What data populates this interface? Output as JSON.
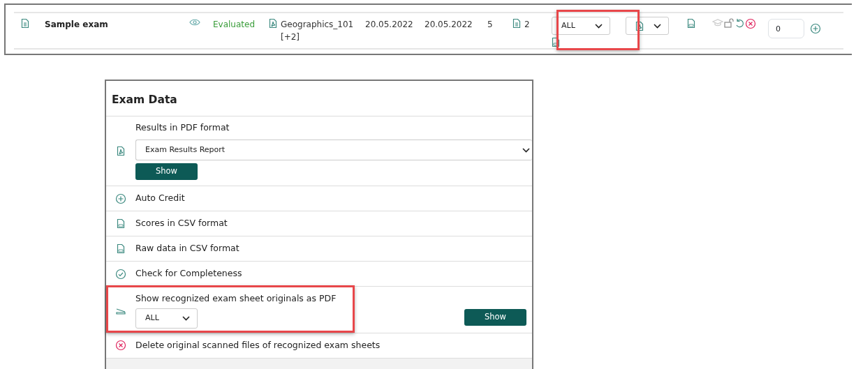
{
  "exam_row": {
    "name": "Sample exam",
    "status": "Evaluated",
    "file": "Geographics_101",
    "file_extra": "[+2]",
    "date_1": "20.05.2022",
    "date_2": "20.05.2022",
    "count": "5",
    "sheets": "2",
    "scope_select": {
      "value": "ALL",
      "highlighted": true
    },
    "points": "0"
  },
  "panel": {
    "title": "Exam Data",
    "items": [
      {
        "kind": "select_action",
        "label": "Results in PDF format",
        "select_value": "Exam Results Report",
        "button": "Show",
        "highlighted": false
      },
      {
        "kind": "plain",
        "label": "Auto Credit",
        "highlighted": false
      },
      {
        "kind": "plain",
        "label": "Scores in CSV format",
        "highlighted": false
      },
      {
        "kind": "plain",
        "label": "Raw data in CSV format",
        "highlighted": false
      },
      {
        "kind": "plain",
        "label": "Check for Completeness",
        "highlighted": false
      },
      {
        "kind": "scope_action",
        "label": "Show recognized exam sheet originals as PDF",
        "select_value": "ALL",
        "button": "Show",
        "highlighted": true
      },
      {
        "kind": "plain",
        "label": "Delete original scanned files of recognized exam sheets",
        "highlighted": false
      }
    ]
  }
}
